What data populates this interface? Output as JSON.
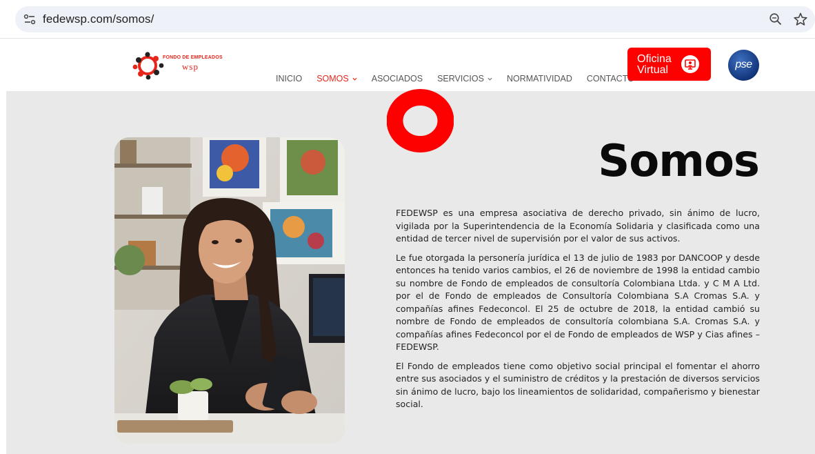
{
  "browser": {
    "url": "fedewsp.com/somos/"
  },
  "header": {
    "logo": {
      "title": "FONDO DE EMPLEADOS",
      "subtitle": "wsp"
    },
    "nav": [
      {
        "label": "INICIO",
        "active": false,
        "has_dropdown": false
      },
      {
        "label": "SOMOS",
        "active": true,
        "has_dropdown": true
      },
      {
        "label": "ASOCIADOS",
        "active": false,
        "has_dropdown": false
      },
      {
        "label": "SERVICIOS",
        "active": false,
        "has_dropdown": true
      },
      {
        "label": "NORMATIVIDAD",
        "active": false,
        "has_dropdown": false
      },
      {
        "label": "CONTACTO",
        "active": false,
        "has_dropdown": false
      }
    ],
    "oficina_virtual": {
      "line1": "Oficina",
      "line2": "Virtual"
    },
    "pse": "pse"
  },
  "main": {
    "title": "Somos",
    "paragraphs": [
      "FEDEWSP es una empresa asociativa de derecho privado, sin ánimo de lucro, vigilada por la Superintendencia de la Economía Solidaria y clasificada como una entidad de tercer nivel de supervisión por el valor de sus activos.",
      "Le fue otorgada la personería jurídica el 13 de julio de 1983 por DANCOOP y desde entonces ha tenido varios cambios, el 26 de noviembre de 1998 la  entidad cambio su nombre de Fondo de empleados de consultoría Colombiana Ltda. y C M A Ltd. por el de Fondo de empleados de Consultoría Colombiana S.A Cromas S.A. y compañías afines Fedeconcol.  El 25 de octubre de 2018, la entidad cambió su nombre de Fondo de empleados de consultoría colombiana S.A. Cromas S.A. y compañías afines Fedeconcol por el de Fondo de empleados de WSP y Cias afines – FEDEWSP.",
      "El Fondo de empleados tiene como objetivo social principal el fomentar el ahorro entre sus asociados y el suministro de créditos y la prestación de diversos servicios sin ánimo de lucro, bajo los lineamientos de solidaridad, compañerismo y bienestar social."
    ]
  },
  "colors": {
    "brand_red": "#fd0000",
    "nav_active": "#e8251b",
    "section_bg": "#e9e9e9",
    "pse_blue": "#12357a"
  }
}
